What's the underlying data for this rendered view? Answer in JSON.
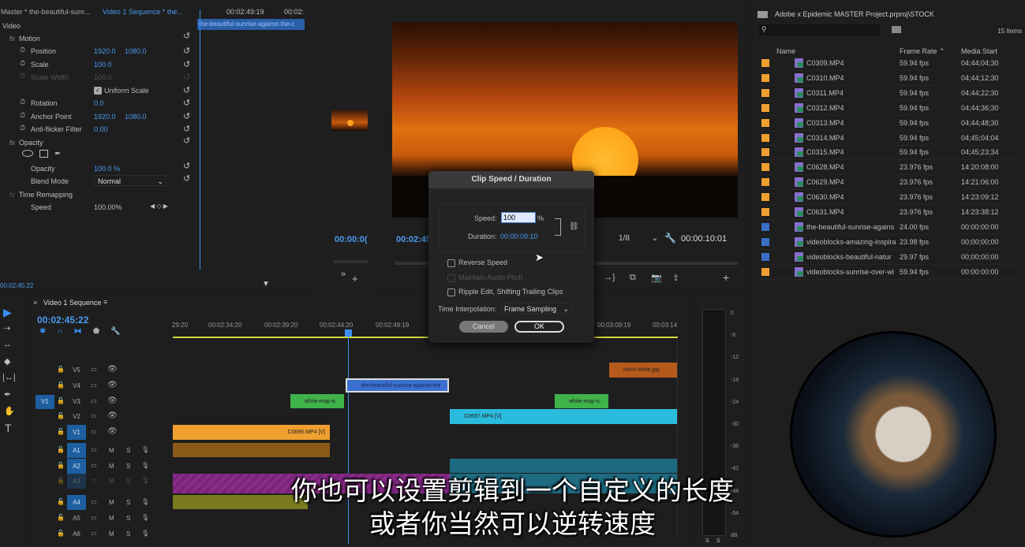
{
  "effect_controls": {
    "source_tab": "Master * the-beautiful-sunr...",
    "sequence_tab": "Video 1 Sequence * the...",
    "section": "Video",
    "mini_time": "00:02:49:19",
    "mini_time2": "00:02:",
    "mini_clip": "the-beautiful-sunrise-against-the-c",
    "current_time": "00:02:45:22",
    "motion": "Motion",
    "props": [
      {
        "label": "Position",
        "v1": "1920.0",
        "v2": "1080.0"
      },
      {
        "label": "Scale",
        "v1": "100.0",
        "v2": ""
      },
      {
        "label": "Scale Width",
        "v1": "100.0",
        "v2": "",
        "disabled": true
      },
      {
        "label": "",
        "v1": "Uniform Scale",
        "v2": "",
        "checkbox": true
      },
      {
        "label": "Rotation",
        "v1": "0.0",
        "v2": ""
      },
      {
        "label": "Anchor Point",
        "v1": "1920.0",
        "v2": "1080.0"
      },
      {
        "label": "Anti-flicker Filter",
        "v1": "0.00",
        "v2": ""
      }
    ],
    "opacity_section": "Opacity",
    "opacity_label": "Opacity",
    "opacity_value": "100.0 %",
    "blend_label": "Blend Mode",
    "blend_value": "Normal",
    "time_remap": "Time Remapping",
    "speed_label": "Speed",
    "speed_value": "100.00%"
  },
  "source_monitor": {
    "timecode": "00:00:0("
  },
  "program_monitor": {
    "timecode": "00:02:45",
    "resolution": "1/8",
    "duration": "00:00:10:01"
  },
  "dialog": {
    "title": "Clip Speed / Duration",
    "speed_label": "Speed:",
    "speed_value": "100",
    "percent": "%",
    "duration_label": "Duration:",
    "duration_value": "00:00:09:10",
    "reverse": "Reverse Speed",
    "maintain": "Maintain Audio Pitch",
    "ripple": "Ripple Edit, Shifting Trailing Clips",
    "interp_label": "Time Interpolation:",
    "interp_value": "Frame Sampling",
    "cancel": "Cancel",
    "ok": "OK"
  },
  "project": {
    "path": "Adobe x Epidemic MASTER Project.prproj\\STOCK",
    "count": "15 Items",
    "columns": [
      "Name",
      "Frame Rate",
      "Media Start"
    ],
    "items": [
      {
        "name": "C0309.MP4",
        "fps": "59.94 fps",
        "start": "04;44;04;30",
        "color": "#f0a030"
      },
      {
        "name": "C0310.MP4",
        "fps": "59.94 fps",
        "start": "04;44;12;30",
        "color": "#f0a030"
      },
      {
        "name": "C0311.MP4",
        "fps": "59.94 fps",
        "start": "04;44;22;30",
        "color": "#f0a030"
      },
      {
        "name": "C0312.MP4",
        "fps": "59.94 fps",
        "start": "04;44;36;30",
        "color": "#f0a030"
      },
      {
        "name": "C0313.MP4",
        "fps": "59.94 fps",
        "start": "04;44;48;30",
        "color": "#f0a030"
      },
      {
        "name": "C0314.MP4",
        "fps": "59.94 fps",
        "start": "04;45;04;04",
        "color": "#f0a030"
      },
      {
        "name": "C0315.MP4",
        "fps": "59.94 fps",
        "start": "04;45;23;34",
        "color": "#f0a030"
      },
      {
        "name": "C0628.MP4",
        "fps": "23.976 fps",
        "start": "14:20:08:00",
        "color": "#f0a030"
      },
      {
        "name": "C0629.MP4",
        "fps": "23.976 fps",
        "start": "14:21:06:00",
        "color": "#f0a030"
      },
      {
        "name": "C0630.MP4",
        "fps": "23.976 fps",
        "start": "14:23:09:12",
        "color": "#f0a030"
      },
      {
        "name": "C0631.MP4",
        "fps": "23.976 fps",
        "start": "14:23:38:12",
        "color": "#f0a030"
      },
      {
        "name": "the-beautiful-sunrise-agains",
        "fps": "24.00 fps",
        "start": "00:00:00:00",
        "color": "#3a6fc8"
      },
      {
        "name": "videoblocks-amazing-inspira",
        "fps": "23.98 fps",
        "start": "00;00;00;00",
        "color": "#3a6fc8"
      },
      {
        "name": "videoblocks-beautiful-natur",
        "fps": "29.97 fps",
        "start": "00;00;00;00",
        "color": "#3a6fc8"
      },
      {
        "name": "videoblocks-sunrise-over-wi",
        "fps": "59.94 fps",
        "start": "00:00:00:00",
        "color": "#f0a030"
      }
    ]
  },
  "timeline": {
    "title": "Video 1 Sequence",
    "timecode": "00:02:45:22",
    "ruler": [
      "29:20",
      "00:02:34:20",
      "00:02:39:20",
      "00:02:44:20",
      "00:02:49:19",
      "00:03:09:19",
      "00:03:14"
    ],
    "source_patch": "V1",
    "tracks": [
      "V5",
      "V4",
      "V3",
      "V2",
      "V1",
      "A1",
      "A2",
      "A3",
      "A4",
      "A5",
      "A6"
    ],
    "clips": [
      {
        "name": "clock-white.jpg",
        "track": "V5"
      },
      {
        "name": "the-beautiful-sunrise-against-the",
        "track": "V4"
      },
      {
        "name": "white-map-ic",
        "track": "V3"
      },
      {
        "name": "white-map-ic",
        "track": "V3"
      },
      {
        "name": "C0697.MP4 [V]",
        "track": "V2"
      },
      {
        "name": "C0696.MP4 [V]",
        "track": "V1"
      }
    ]
  },
  "meter": {
    "ticks": [
      "0",
      "-6",
      "-12",
      "-18",
      "-24",
      "-30",
      "-36",
      "-42",
      "-48",
      "-54",
      "dB"
    ],
    "solo": [
      "S",
      "S"
    ]
  },
  "subtitles": [
    "你也可以设置剪辑到一个自定义的长度",
    "或者你当然可以逆转速度"
  ],
  "colors": {
    "accent": "#4a9af0",
    "playhead": "#3a8ef0"
  }
}
